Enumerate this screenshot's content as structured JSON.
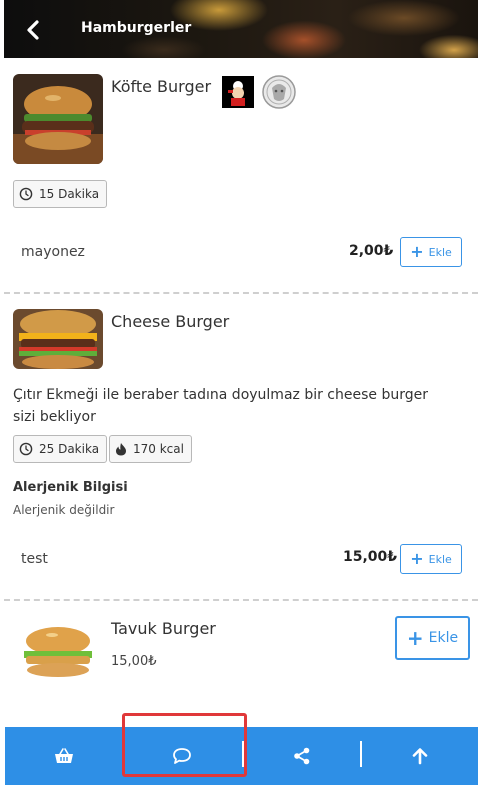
{
  "header": {
    "title": "Hamburgerler",
    "back_icon": "chevron-left-icon"
  },
  "items": [
    {
      "name": "Köfte Burger",
      "time": "15 Dakika",
      "option": {
        "label": "mayonez",
        "price": "2,00₺",
        "button": "Ekle"
      }
    },
    {
      "name": "Cheese Burger",
      "description": "Çıtır Ekmeği ile beraber tadına doyulmaz bir cheese burger sizi bekliyor",
      "time": "25 Dakika",
      "calories": "170 kcal",
      "allergen_title": "Alerjenik Bilgisi",
      "allergen_text": "Alerjenik değildir",
      "option": {
        "label": "test",
        "price": "15,00₺",
        "button": "Ekle"
      }
    },
    {
      "name": "Tavuk Burger",
      "price": "15,00₺",
      "button": "Ekle"
    }
  ],
  "bottom_bar": {
    "icons": [
      "basket-icon",
      "chat-bubble-icon",
      "share-icon",
      "arrow-up-icon"
    ],
    "color": "#2e8fe6"
  },
  "colors": {
    "accent": "#3a94e6",
    "highlight": "#e0383a"
  }
}
